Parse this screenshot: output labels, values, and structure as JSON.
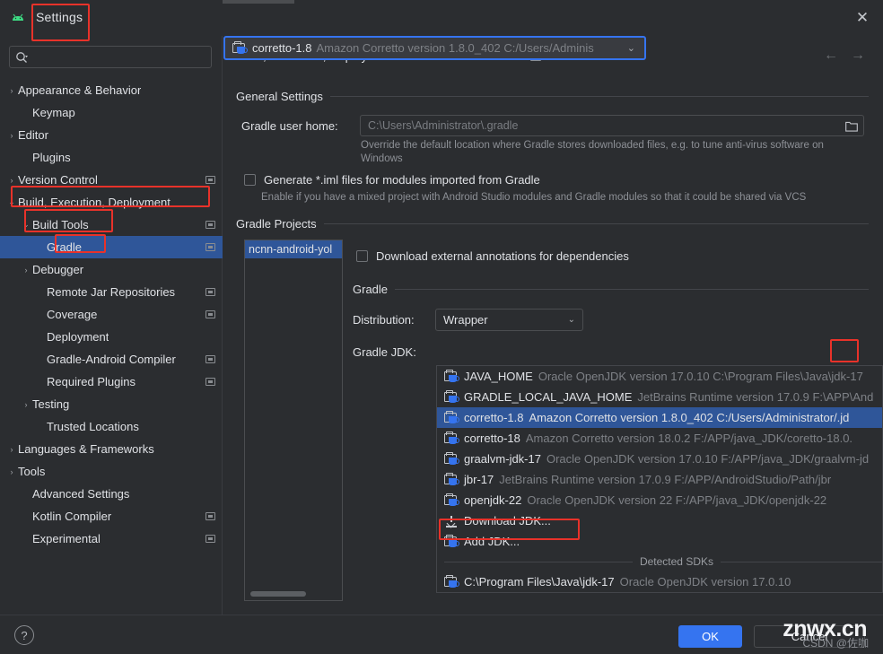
{
  "window": {
    "title": "Settings",
    "close_label": "✕",
    "app_icon": "android-logo-icon"
  },
  "sidebar": {
    "search": {
      "placeholder": "",
      "value": "",
      "icon": "search-icon"
    },
    "items": [
      {
        "label": "Appearance & Behavior",
        "indent": 1,
        "arrow": "›",
        "badge": false,
        "selected": false
      },
      {
        "label": "Keymap",
        "indent": 2,
        "arrow": "",
        "badge": false,
        "selected": false
      },
      {
        "label": "Editor",
        "indent": 1,
        "arrow": "›",
        "badge": false,
        "selected": false
      },
      {
        "label": "Plugins",
        "indent": 2,
        "arrow": "",
        "badge": false,
        "selected": false
      },
      {
        "label": "Version Control",
        "indent": 1,
        "arrow": "›",
        "badge": true,
        "selected": false
      },
      {
        "label": "Build, Execution, Deployment",
        "indent": 1,
        "arrow": "⌄",
        "badge": false,
        "selected": false
      },
      {
        "label": "Build Tools",
        "indent": 2,
        "arrow": "⌄",
        "badge": true,
        "selected": false
      },
      {
        "label": "Gradle",
        "indent": 3,
        "arrow": "",
        "badge": true,
        "selected": true
      },
      {
        "label": "Debugger",
        "indent": 2,
        "arrow": "›",
        "badge": false,
        "selected": false
      },
      {
        "label": "Remote Jar Repositories",
        "indent": 3,
        "arrow": "",
        "badge": true,
        "selected": false
      },
      {
        "label": "Coverage",
        "indent": 3,
        "arrow": "",
        "badge": true,
        "selected": false
      },
      {
        "label": "Deployment",
        "indent": 3,
        "arrow": "",
        "badge": false,
        "selected": false
      },
      {
        "label": "Gradle-Android Compiler",
        "indent": 3,
        "arrow": "",
        "badge": true,
        "selected": false
      },
      {
        "label": "Required Plugins",
        "indent": 3,
        "arrow": "",
        "badge": true,
        "selected": false
      },
      {
        "label": "Testing",
        "indent": 2,
        "arrow": "›",
        "badge": false,
        "selected": false
      },
      {
        "label": "Trusted Locations",
        "indent": 3,
        "arrow": "",
        "badge": false,
        "selected": false
      },
      {
        "label": "Languages & Frameworks",
        "indent": 1,
        "arrow": "›",
        "badge": false,
        "selected": false
      },
      {
        "label": "Tools",
        "indent": 1,
        "arrow": "›",
        "badge": false,
        "selected": false
      },
      {
        "label": "Advanced Settings",
        "indent": 2,
        "arrow": "",
        "badge": false,
        "selected": false
      },
      {
        "label": "Kotlin Compiler",
        "indent": 2,
        "arrow": "",
        "badge": true,
        "selected": false
      },
      {
        "label": "Experimental",
        "indent": 2,
        "arrow": "",
        "badge": true,
        "selected": false
      }
    ]
  },
  "main": {
    "breadcrumb": [
      "Build, Execution, Deployment",
      "Build Tools",
      "Gradle"
    ],
    "breadcrumb_separator": "›",
    "nav_back": "←",
    "nav_forward": "→",
    "general_settings_title": "General Settings",
    "gradle_user_home_label": "Gradle user home:",
    "gradle_user_home_placeholder": "C:\\Users\\Administrator\\.gradle",
    "gradle_user_home_value": "",
    "gradle_user_home_hint": "Override the default location where Gradle stores downloaded files, e.g. to tune anti-virus software on Windows",
    "generate_iml_label": "Generate *.iml files for modules imported from Gradle",
    "generate_iml_hint": "Enable if you have a mixed project with Android Studio modules and Gradle modules so that it could be shared via VCS",
    "gradle_projects_title": "Gradle Projects",
    "project_list": [
      "ncnn-android-yol"
    ],
    "download_annotations_label": "Download external annotations for dependencies",
    "gradle_section_title": "Gradle",
    "distribution_label": "Distribution:",
    "distribution_value": "Wrapper",
    "gradle_jdk_label": "Gradle JDK:",
    "gradle_jdk_name": "corretto-1.8",
    "gradle_jdk_desc": "Amazon Corretto version 1.8.0_402 C:/Users/Adminis"
  },
  "dropdown": {
    "items": [
      {
        "icon": "jdk-icon",
        "name": "JAVA_HOME",
        "desc": "Oracle OpenJDK version 17.0.10 C:\\Program Files\\Java\\jdk-17",
        "selected": false
      },
      {
        "icon": "jdk-icon",
        "name": "GRADLE_LOCAL_JAVA_HOME",
        "desc": "JetBrains Runtime version 17.0.9 F:\\APP\\And",
        "selected": false
      },
      {
        "icon": "jdk-icon",
        "name": "corretto-1.8",
        "desc": "Amazon Corretto version 1.8.0_402 C:/Users/Administrator/.jd",
        "selected": true
      },
      {
        "icon": "jdk-icon",
        "name": "corretto-18",
        "desc": "Amazon Corretto version 18.0.2 F:/APP/java_JDK/coretto-18.0.",
        "selected": false
      },
      {
        "icon": "jdk-icon",
        "name": "graalvm-jdk-17",
        "desc": "Oracle OpenJDK version 17.0.10 F:/APP/java_JDK/graalvm-jd",
        "selected": false
      },
      {
        "icon": "jdk-icon",
        "name": "jbr-17",
        "desc": "JetBrains Runtime version 17.0.9 F:/APP/AndroidStudio/Path/jbr",
        "selected": false
      },
      {
        "icon": "jdk-icon",
        "name": "openjdk-22",
        "desc": "Oracle OpenJDK version 22 F:/APP/java_JDK/openjdk-22",
        "selected": false
      },
      {
        "icon": "download-icon",
        "name": "Download JDK...",
        "desc": "",
        "selected": false
      },
      {
        "icon": "jdk-icon",
        "name": "Add JDK...",
        "desc": "",
        "selected": false
      }
    ],
    "detected_sdks_caption": "Detected SDKs",
    "detected_items": [
      {
        "icon": "jdk-icon",
        "name": "C:\\Program Files\\Java\\jdk-17",
        "desc": "Oracle OpenJDK version 17.0.10"
      }
    ]
  },
  "footer": {
    "help_label": "?",
    "ok_label": "OK",
    "cancel_label": "Cancel"
  },
  "watermark": {
    "main": "znwx.cn",
    "sub": "CSDN @佐咖"
  },
  "colors": {
    "accent": "#3574f0",
    "selection": "#2f5699",
    "annotation": "#e8322a",
    "background": "#2b2d30"
  }
}
